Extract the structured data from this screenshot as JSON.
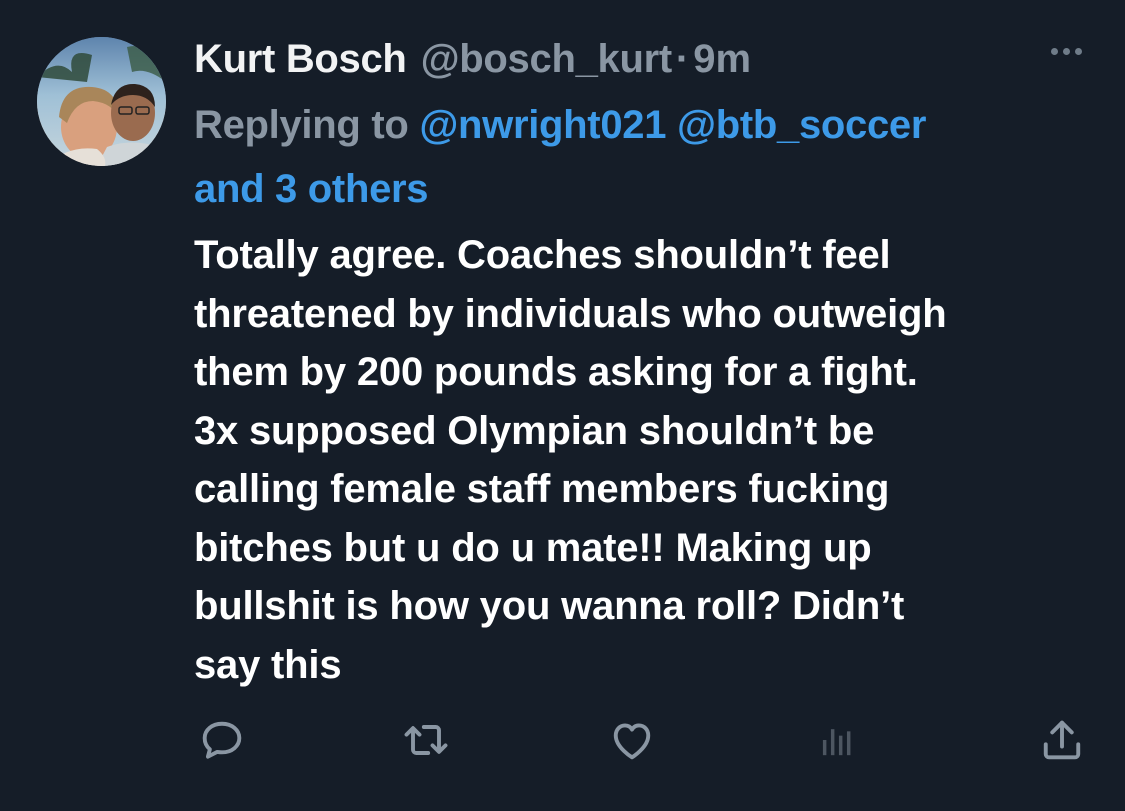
{
  "tweet": {
    "author_name": "Kurt Bosch",
    "author_handle": "@bosch_kurt",
    "separator": "·",
    "time": "9m",
    "replying_label": "Replying to",
    "reply_mentions": [
      "@nwright021",
      "@btb_soccer"
    ],
    "reply_others": "and 3 others",
    "body": "Totally agree.  Coaches shouldn’t feel\nthreatened by individuals who outweigh\nthem by 200 pounds asking for a fight.\n3x supposed Olympian shouldn’t be\ncalling female staff members fucking\nbitches but u do u mate!! Making up\nbullshit is how you wanna roll?  Didn’t\nsay this"
  },
  "icons": {
    "more": "more-horizontal-icon",
    "reply": "reply-bubble-icon",
    "retweet": "retweet-icon",
    "like": "heart-icon",
    "views": "analytics-bars-icon",
    "share": "share-upload-icon"
  },
  "colors": {
    "background": "#151d28",
    "text_primary": "#ffffff",
    "text_secondary": "#8a96a3",
    "link": "#3d9ae8",
    "icon": "#8a96a3"
  }
}
